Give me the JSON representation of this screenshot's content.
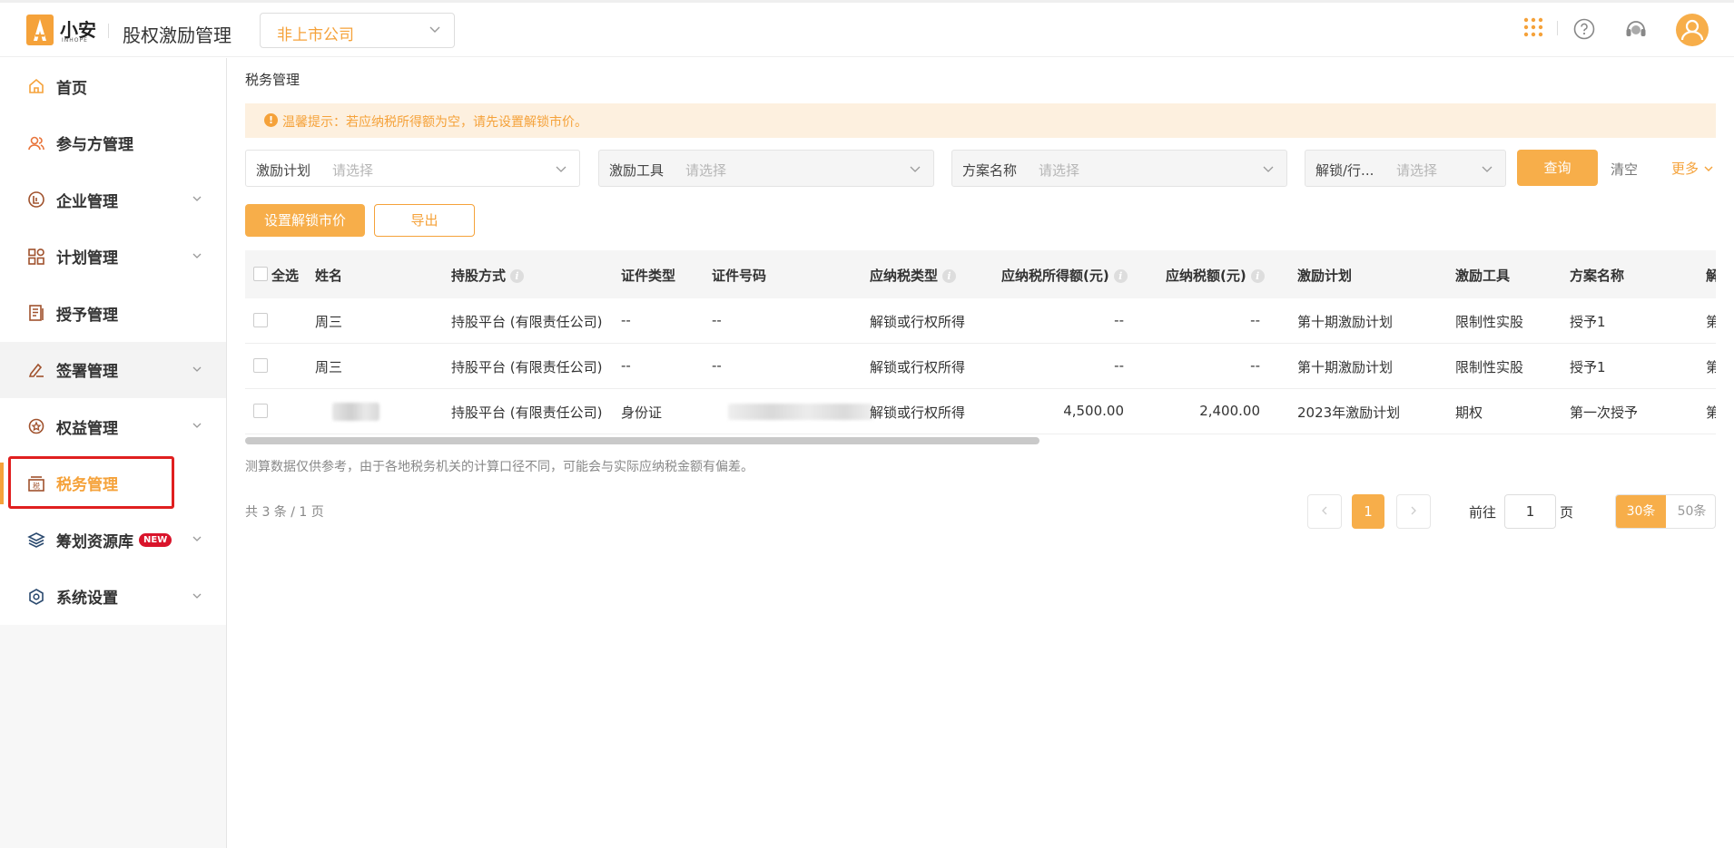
{
  "brand": {
    "logo_text": "小安",
    "logo_sub": "INHOPE",
    "app_title": "股权激励管理"
  },
  "company_select": {
    "value": "非上市公司"
  },
  "sidebar": {
    "items": [
      {
        "label": "首页",
        "icon": "home-icon"
      },
      {
        "label": "参与方管理",
        "icon": "users-icon"
      },
      {
        "label": "企业管理",
        "icon": "enterprise-icon"
      },
      {
        "label": "计划管理",
        "icon": "plan-grid-icon"
      },
      {
        "label": "授予管理",
        "icon": "document-icon"
      },
      {
        "label": "签署管理",
        "icon": "pen-icon"
      },
      {
        "label": "权益管理",
        "icon": "equity-badge-icon"
      },
      {
        "label": "税务管理",
        "icon": "tax-icon"
      },
      {
        "label": "筹划资源库",
        "icon": "layers-icon",
        "badge": "NEW"
      },
      {
        "label": "系统设置",
        "icon": "settings-icon"
      }
    ]
  },
  "breadcrumb": "税务管理",
  "notice": "温馨提示：若应纳税所得额为空，请先设置解锁市价。",
  "filters": [
    {
      "label": "激励计划",
      "placeholder": "请选择"
    },
    {
      "label": "激励工具",
      "placeholder": "请选择"
    },
    {
      "label": "方案名称",
      "placeholder": "请选择"
    },
    {
      "label": "解锁/行...",
      "placeholder": "请选择"
    }
  ],
  "actions": {
    "query": "查询",
    "clear": "清空",
    "more": "更多",
    "set_price": "设置解锁市价",
    "export": "导出"
  },
  "table": {
    "headers": [
      "全选",
      "姓名",
      "持股方式",
      "证件类型",
      "证件号码",
      "应纳税类型",
      "应纳税所得额(元)",
      "应纳税额(元)",
      "激励计划",
      "激励工具",
      "方案名称",
      "解锁"
    ],
    "rows": [
      {
        "name": "周三",
        "method": "持股平台 (有限责任公司)",
        "id_type": "--",
        "id_no": "--",
        "tax_type": "解锁或行权所得",
        "taxable_income": "--",
        "tax": "--",
        "plan": "第十期激励计划",
        "tool": "限制性实股",
        "scheme": "授予1",
        "unlock": "第一·"
      },
      {
        "name": "周三",
        "method": "持股平台 (有限责任公司)",
        "id_type": "--",
        "id_no": "--",
        "tax_type": "解锁或行权所得",
        "taxable_income": "--",
        "tax": "--",
        "plan": "第十期激励计划",
        "tool": "限制性实股",
        "scheme": "授予1",
        "unlock": "第三·"
      },
      {
        "name": "",
        "method": "持股平台 (有限责任公司)",
        "id_type": "身份证",
        "id_no": "",
        "tax_type": "解锁或行权所得",
        "taxable_income": "4,500.00",
        "tax": "2,400.00",
        "plan": "2023年激励计划",
        "tool": "期权",
        "scheme": "第一次授予",
        "unlock": "第一·"
      }
    ]
  },
  "footnote": "测算数据仅供参考，由于各地税务机关的计算口径不同，可能会与实际应纳税金额有偏差。",
  "pagination": {
    "total": "共 3 条 / 1 页",
    "current": "1",
    "goto_prefix": "前往",
    "goto_value": "1",
    "goto_suffix": "页",
    "size_selected": "30条",
    "size_other": "50条"
  },
  "colors": {
    "accent": "#f5a23a",
    "button": "#f7ae4a",
    "highlight": "#e01f1f",
    "new_badge": "#d9142b"
  }
}
